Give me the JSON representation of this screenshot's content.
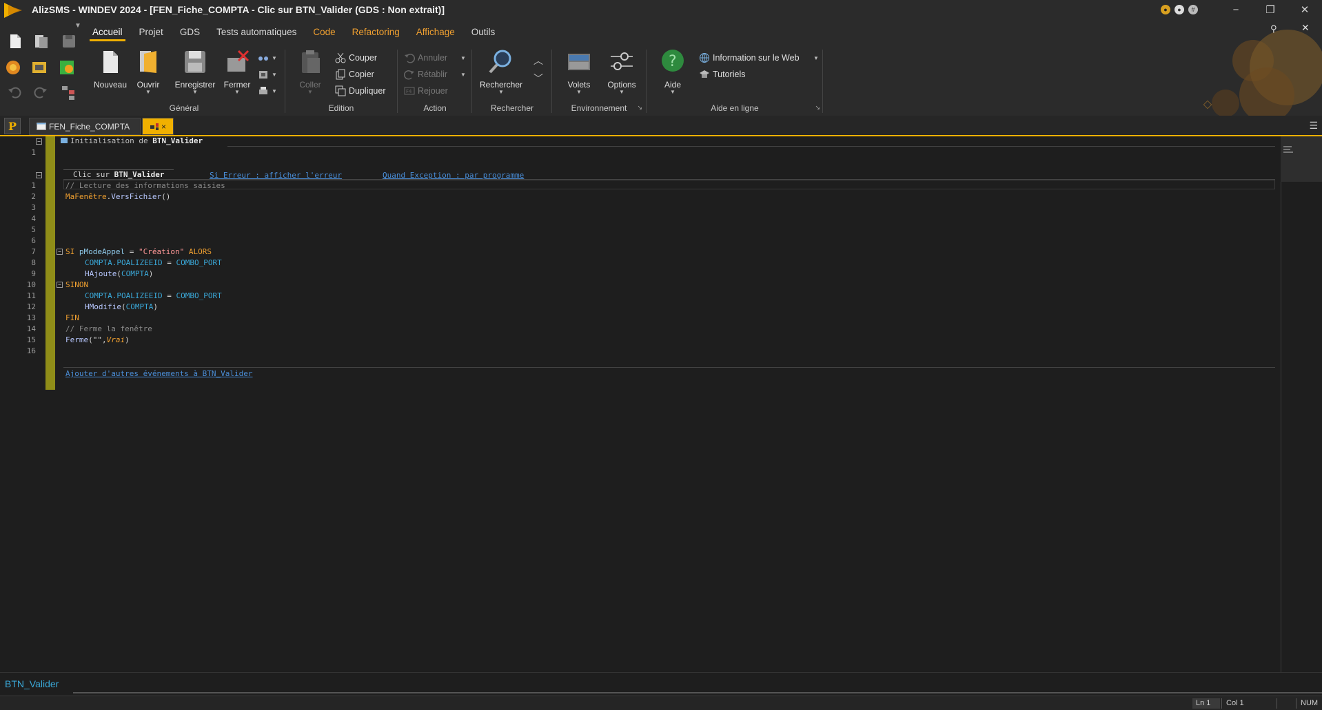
{
  "window": {
    "title": "AlizSMS - WINDEV 2024 - [FEN_Fiche_COMPTA - Clic sur BTN_Valider (GDS : Non extrait)]",
    "minimize": "−",
    "restore": "❐",
    "close": "✕"
  },
  "ribbon": {
    "tabs": [
      {
        "label": "Accueil",
        "active": true
      },
      {
        "label": "Projet"
      },
      {
        "label": "GDS"
      },
      {
        "label": "Tests automatiques"
      },
      {
        "label": "Code",
        "accent": "#f0a030"
      },
      {
        "label": "Refactoring",
        "accent": "#f0a030"
      },
      {
        "label": "Affichage",
        "accent": "#f0a030"
      },
      {
        "label": "Outils"
      }
    ],
    "general": {
      "label": "Général",
      "nouveau": "Nouveau",
      "ouvrir": "Ouvrir",
      "enregistrer": "Enregistrer",
      "fermer": "Fermer"
    },
    "edition": {
      "label": "Edition",
      "coller": "Coller",
      "couper": "Couper",
      "copier": "Copier",
      "dupliquer": "Dupliquer"
    },
    "action": {
      "label": "Action",
      "annuler": "Annuler",
      "retablir": "Rétablir",
      "rejouer": "Rejouer"
    },
    "rechercher": {
      "label": "Rechercher",
      "button": "Rechercher"
    },
    "environnement": {
      "label": "Environnement",
      "volets": "Volets",
      "options": "Options"
    },
    "aide": {
      "label": "Aide en ligne",
      "aide": "Aide",
      "info_web": "Information sur le Web",
      "tutoriels": "Tutoriels"
    }
  },
  "doc_tabs": {
    "p_button": "P",
    "tab1": "FEN_Fiche_COMPTA",
    "tab2_close": "×"
  },
  "editor": {
    "init_header_prefix": "Initialisation de ",
    "init_header_name": "BTN_Valider",
    "init_line_number": "1",
    "click_header_prefix": "Clic sur ",
    "click_header_name": "BTN_Valider",
    "si_erreur": "Si Erreur : afficher l'erreur",
    "quand_exception": "Quand Exception : par programme",
    "line_numbers": [
      "1",
      "2",
      "3",
      "4",
      "5",
      "6",
      "7",
      "8",
      "9",
      "10",
      "11",
      "12",
      "13",
      "14",
      "15",
      "16"
    ],
    "code": {
      "l1_comment": "// Lecture des informations saisies",
      "l2_obj": "MaFenêtre",
      "l2_dot": ".",
      "l2_fn": "VersFichier",
      "l2_paren": "()",
      "l7_si": "SI ",
      "l7_var": "pModeAppel",
      "l7_eq": " = ",
      "l7_str": "\"Création\"",
      "l7_alors": " ALORS",
      "l8_file": "COMPTA",
      "l8_field": ".POALIZEEID",
      "l8_eq": " = ",
      "l8_combo": "COMBO_PORT",
      "l9_fn": "HAjoute",
      "l9_open": "(",
      "l9_arg": "COMPTA",
      "l9_close": ")",
      "l10_sinon": "SINON",
      "l11_file": "COMPTA",
      "l11_field": ".POALIZEEID",
      "l11_eq": " = ",
      "l11_combo": "COMBO_PORT",
      "l12_fn": "HModifie",
      "l12_open": "(",
      "l12_arg": "COMPTA",
      "l12_close": ")",
      "l13_fin": "FIN",
      "l14_comment": "// Ferme la fenêtre",
      "l15_fn": "Ferme",
      "l15_args": "(\"\",",
      "l15_vrai": "Vrai",
      "l15_close": ")"
    },
    "add_events_link": "Ajouter d'autres événements à BTN_Valider"
  },
  "bottom_panel": {
    "label": "BTN_Valider"
  },
  "status_bar": {
    "ln": "Ln 1",
    "col": "Col 1",
    "num": "NUM"
  },
  "colors": {
    "accent": "#f0b000",
    "gutter": "#8f8d18",
    "keyword": "#f0a030",
    "link": "#4a8ed8"
  }
}
